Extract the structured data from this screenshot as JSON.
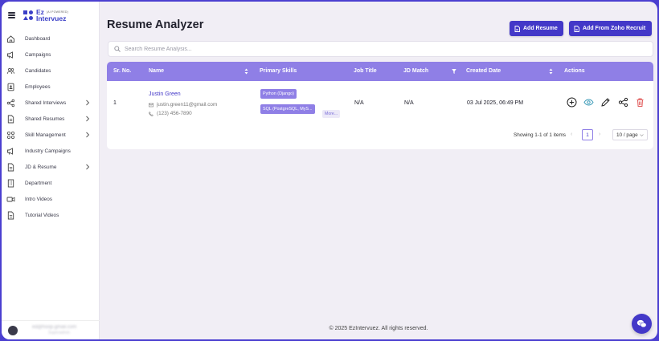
{
  "logo": {
    "line1": "Ez",
    "powered": "(AI POWERED)",
    "line2": "Intervuez"
  },
  "sidebar": {
    "items": [
      {
        "label": "Dashboard",
        "icon": "home-icon",
        "chevron": false
      },
      {
        "label": "Campaigns",
        "icon": "megaphone-icon",
        "chevron": false
      },
      {
        "label": "Candidates",
        "icon": "users-icon",
        "chevron": false
      },
      {
        "label": "Employees",
        "icon": "id-badge-icon",
        "chevron": false
      },
      {
        "label": "Shared Interviews",
        "icon": "share-icon",
        "chevron": true
      },
      {
        "label": "Shared Resumes",
        "icon": "document-icon",
        "chevron": true
      },
      {
        "label": "Skill Management",
        "icon": "grid-icon",
        "chevron": true
      },
      {
        "label": "Industry Campaigns",
        "icon": "megaphone-icon",
        "chevron": false
      },
      {
        "label": "JD & Resume",
        "icon": "document-icon",
        "chevron": true
      },
      {
        "label": "Department",
        "icon": "building-icon",
        "chevron": false
      },
      {
        "label": "Intro Videos",
        "icon": "video-icon",
        "chevron": false
      },
      {
        "label": "Tutorial Videos",
        "icon": "document-icon",
        "chevron": false
      }
    ],
    "user": {
      "email": "ed@hoop.gmail.com",
      "role": "Superadmin"
    }
  },
  "header": {
    "title": "Resume Analyzer",
    "add_resume_label": "Add Resume",
    "add_zoho_label": "Add From Zoho Recruit"
  },
  "search": {
    "placeholder": "Search Resume Analysis...",
    "value": ""
  },
  "table": {
    "columns": [
      "Sr. No.",
      "Name",
      "Primary Skills",
      "Job Title",
      "JD Match",
      "Created Date",
      "Actions"
    ],
    "rows": [
      {
        "sr": "1",
        "name": "Justin Green",
        "email": "justin.green11@gmail.com",
        "phone": "(123) 456-7890",
        "skills": [
          "Python (Django)",
          "SQL (PostgreSQL, MyS..."
        ],
        "more_label": "More...",
        "job_title": "N/A",
        "jd_match": "N/A",
        "created": "03 Jul 2025, 06:49 PM"
      }
    ]
  },
  "pagination": {
    "summary": "Showing 1-1 of 1 items",
    "current_page": "1",
    "page_size": "10 / page"
  },
  "footer": {
    "text": "© 2025 EzIntervuez. All rights reserved."
  },
  "colors": {
    "accent": "#4338c8",
    "header_bg": "#8f7fe6",
    "page_bg": "#f1eef5",
    "delete": "#e05555",
    "view": "#3d9bb8"
  }
}
